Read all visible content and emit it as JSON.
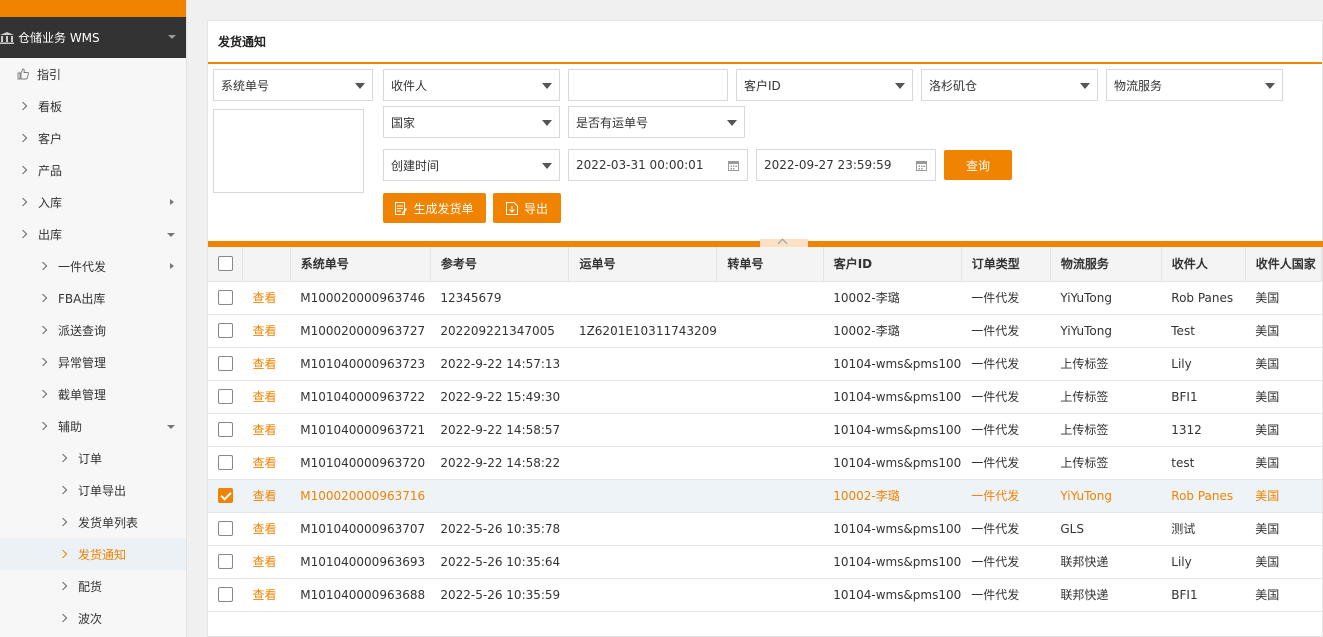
{
  "sidebar": {
    "title": "仓储业务 WMS",
    "items": [
      {
        "label": "指引",
        "level": 0,
        "icon": "thumbs-up-icon"
      },
      {
        "label": "看板",
        "level": 0
      },
      {
        "label": "客户",
        "level": 0
      },
      {
        "label": "产品",
        "level": 0
      },
      {
        "label": "入库",
        "level": 0,
        "indicator": "right"
      },
      {
        "label": "出库",
        "level": 0,
        "indicator": "down"
      },
      {
        "label": "一件代发",
        "level": 1,
        "indicator": "right"
      },
      {
        "label": "FBA出库",
        "level": 1
      },
      {
        "label": "派送查询",
        "level": 1
      },
      {
        "label": "异常管理",
        "level": 1
      },
      {
        "label": "截单管理",
        "level": 1
      },
      {
        "label": "辅助",
        "level": 1,
        "indicator": "down"
      },
      {
        "label": "订单",
        "level": 2
      },
      {
        "label": "订单导出",
        "level": 2
      },
      {
        "label": "发货单列表",
        "level": 2
      },
      {
        "label": "发货通知",
        "level": 2,
        "active": true
      },
      {
        "label": "配货",
        "level": 2
      },
      {
        "label": "波次",
        "level": 2
      }
    ]
  },
  "page": {
    "title": "发货通知"
  },
  "filters": {
    "system_no": "系统单号",
    "recipient": "收件人",
    "free_text": "",
    "customer_id": "客户ID",
    "warehouse": "洛杉矶仓",
    "logistics": "物流服务",
    "country": "国家",
    "has_tracking": "是否有运单号",
    "created_time": "创建时间",
    "date_from": "2022-03-31 00:00:01",
    "date_to": "2022-09-27 23:59:59",
    "query_label": "查询",
    "generate_label": "生成发货单",
    "export_label": "导出"
  },
  "table": {
    "headers": [
      "系统单号",
      "参考号",
      "运单号",
      "转单号",
      "客户ID",
      "订单类型",
      "物流服务",
      "收件人",
      "收件人国家"
    ],
    "view_label": "查看",
    "rows": [
      {
        "sys": "M100020000963746",
        "ref": "12345679",
        "track": "",
        "trans": "",
        "cust": "10002-李璐",
        "type": "一件代发",
        "svc": "YiYuTong",
        "recv": "Rob Panes",
        "country": "美国",
        "checked": false
      },
      {
        "sys": "M100020000963727",
        "ref": "202209221347005",
        "track": "1Z6201E10311743209",
        "trans": "",
        "cust": "10002-李璐",
        "type": "一件代发",
        "svc": "YiYuTong",
        "recv": "Test",
        "country": "美国",
        "checked": false
      },
      {
        "sys": "M101040000963723",
        "ref": "2022-9-22 14:57:13",
        "track": "",
        "trans": "",
        "cust": "10104-wms&pms100",
        "type": "一件代发",
        "svc": "上传标签",
        "recv": "Lily",
        "country": "美国",
        "checked": false
      },
      {
        "sys": "M101040000963722",
        "ref": "2022-9-22 15:49:30",
        "track": "",
        "trans": "",
        "cust": "10104-wms&pms100",
        "type": "一件代发",
        "svc": "上传标签",
        "recv": "BFI1",
        "country": "美国",
        "checked": false
      },
      {
        "sys": "M101040000963721",
        "ref": "2022-9-22 14:58:57",
        "track": "",
        "trans": "",
        "cust": "10104-wms&pms100",
        "type": "一件代发",
        "svc": "上传标签",
        "recv": "1312",
        "country": "美国",
        "checked": false
      },
      {
        "sys": "M101040000963720",
        "ref": "2022-9-22 14:58:22",
        "track": "",
        "trans": "",
        "cust": "10104-wms&pms100",
        "type": "一件代发",
        "svc": "上传标签",
        "recv": "test",
        "country": "美国",
        "checked": false
      },
      {
        "sys": "M100020000963716",
        "ref": "",
        "track": "",
        "trans": "",
        "cust": "10002-李璐",
        "type": "一件代发",
        "svc": "YiYuTong",
        "recv": "Rob Panes",
        "country": "美国",
        "checked": true
      },
      {
        "sys": "M101040000963707",
        "ref": "2022-5-26 10:35:78",
        "track": "",
        "trans": "",
        "cust": "10104-wms&pms100",
        "type": "一件代发",
        "svc": "GLS",
        "recv": "测试",
        "country": "美国",
        "checked": false
      },
      {
        "sys": "M101040000963693",
        "ref": "2022-5-26 10:35:64",
        "track": "",
        "trans": "",
        "cust": "10104-wms&pms100",
        "type": "一件代发",
        "svc": "联邦快递",
        "recv": "Lily",
        "country": "美国",
        "checked": false
      },
      {
        "sys": "M101040000963688",
        "ref": "2022-5-26 10:35:59",
        "track": "",
        "trans": "",
        "cust": "10104-wms&pms100",
        "type": "一件代发",
        "svc": "联邦快递",
        "recv": "BFI1",
        "country": "美国",
        "checked": false
      }
    ]
  }
}
